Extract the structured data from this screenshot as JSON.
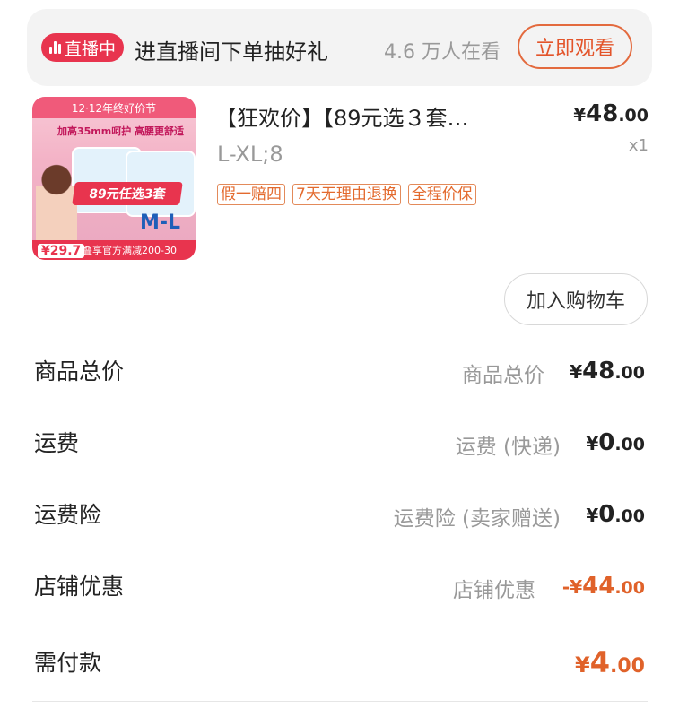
{
  "live": {
    "badge_label": "直播中",
    "text": "进直播间下单抽好礼",
    "viewers": "4.6 万人在看",
    "watch_button": "立即观看",
    "accent_color": "#e8344e"
  },
  "product": {
    "thumbnail": {
      "banner": "12·12年终好价节",
      "subtitle": "加高35mm呵护 高腰更舒适",
      "ribbon": "89元任选3套",
      "size_label": "M-L",
      "price_tag": "¥29.7",
      "bottom_text": "叠享官方满减200-30"
    },
    "title": "【狂欢价】【89元选３套…",
    "price": {
      "yen": "¥",
      "int": "48",
      "dec": ".00"
    },
    "quantity": "x1",
    "variant": "L-XL;8",
    "tags": [
      "假一赔四",
      "7天无理由退换",
      "全程价保"
    ],
    "add_to_cart": "加入购物车"
  },
  "summary": {
    "goods_total": {
      "label": "商品总价",
      "sub": "商品总价",
      "yen": "¥",
      "int": "48",
      "dec": ".00"
    },
    "shipping": {
      "label": "运费",
      "sub": "运费 (快递)",
      "yen": "¥",
      "int": "0",
      "dec": ".00"
    },
    "shipping_insurance": {
      "label": "运费险",
      "sub": "运费险 (卖家赠送)",
      "yen": "¥",
      "int": "0",
      "dec": ".00"
    },
    "store_discount": {
      "label": "店铺优惠",
      "sub": "店铺优惠",
      "prefix": "-",
      "yen": "¥",
      "int": "44",
      "dec": ".00"
    },
    "payable": {
      "label": "需付款",
      "yen": "¥",
      "int": "4",
      "dec": ".00"
    }
  }
}
